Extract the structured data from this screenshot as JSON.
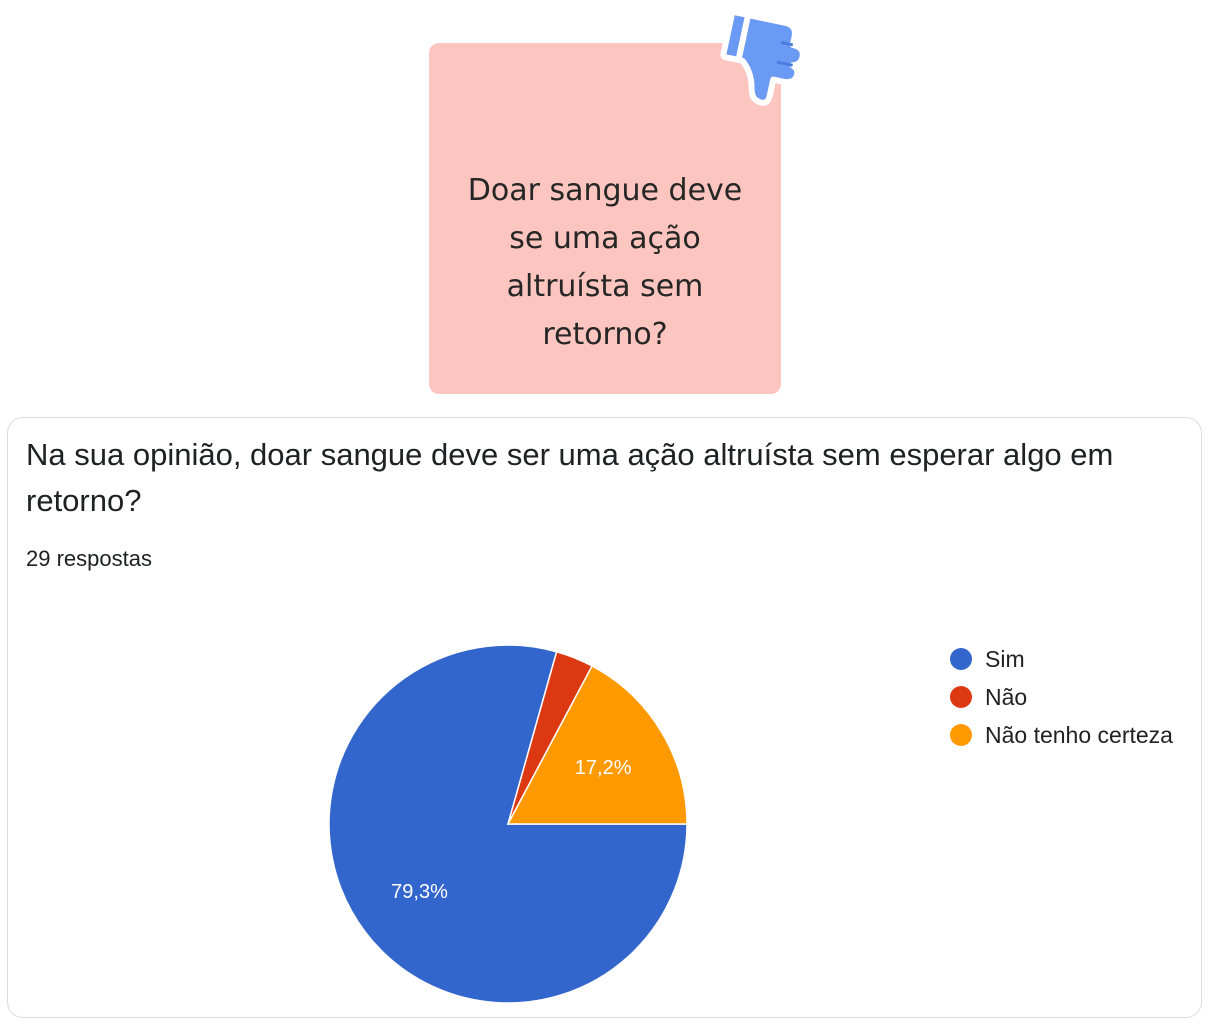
{
  "sticky_note": {
    "text": "Doar sangue deve\nse uma ação\naltruísta sem\nretorno?",
    "background": "#fcc5bf",
    "icon": "thumbs-down-icon",
    "icon_color": "#6b9af5"
  },
  "card": {
    "question": "Na sua opinião, doar sangue deve ser uma ação altruísta sem esperar algo em retorno?",
    "responses": "29 respostas"
  },
  "chart_data": {
    "type": "pie",
    "title": "",
    "total": 29,
    "categories": [
      "Sim",
      "Não",
      "Não tenho certeza"
    ],
    "values": [
      79.3,
      3.4,
      17.2
    ],
    "counts": [
      23,
      1,
      5
    ],
    "data_labels": [
      "79,3%",
      "",
      "17,2%"
    ],
    "colors": [
      "#3366cc",
      "#dc3912",
      "#ff9900"
    ],
    "legend_position": "right",
    "start_angle": "90 degrees clockwise from top (3 o'clock)",
    "direction": "clockwise"
  }
}
